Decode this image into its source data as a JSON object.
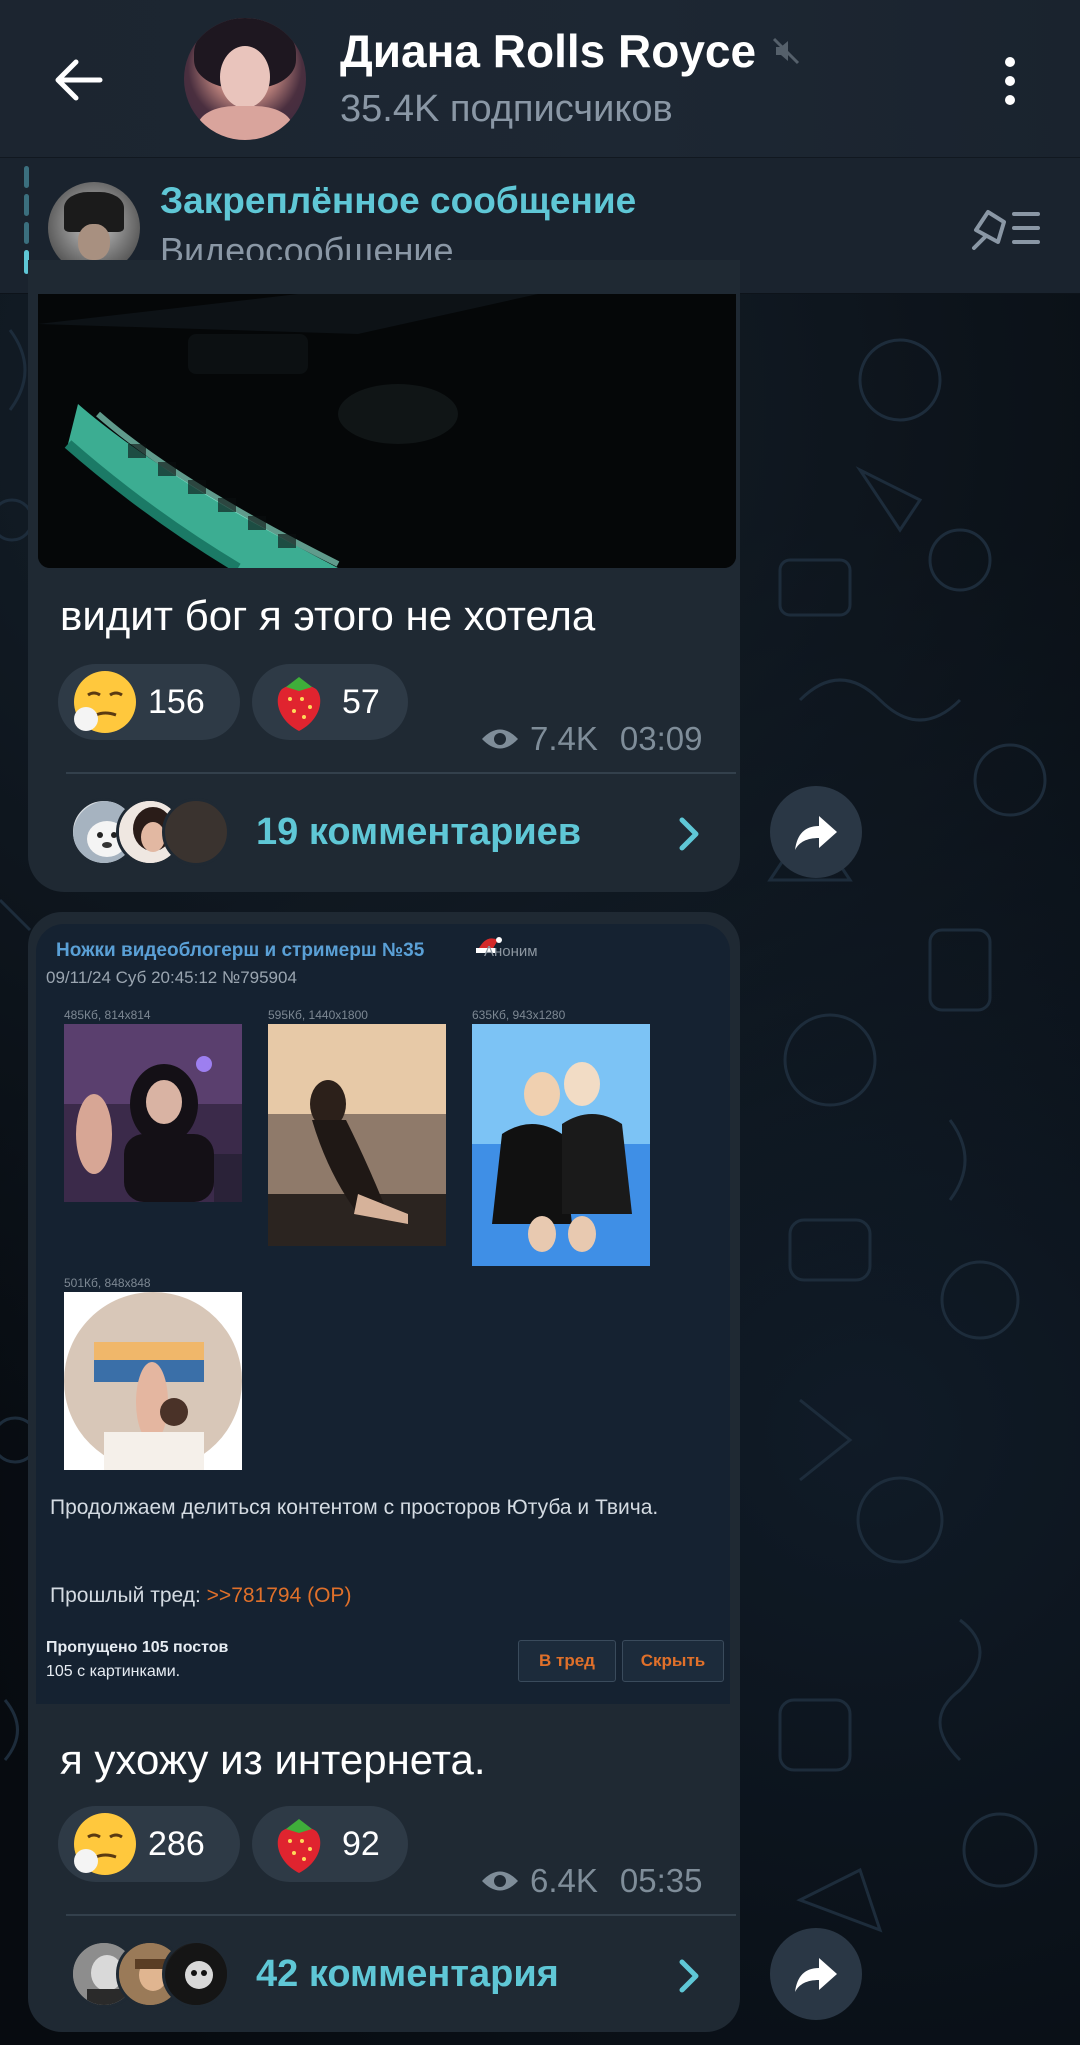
{
  "header": {
    "channel_name": "Диана Rolls Royce",
    "subscribers": "35.4K подписчиков"
  },
  "pinned": {
    "label": "Закреплённое сообщение",
    "text": "Видеосообщение"
  },
  "messages": [
    {
      "text": "видит бог я этого не хотела",
      "reactions": [
        {
          "emoji": "unamused-face-icon",
          "count": "156"
        },
        {
          "emoji": "strawberry-icon",
          "count": "57"
        }
      ],
      "views": "7.4K",
      "time": "03:09",
      "comments": "19 комментариев"
    },
    {
      "embedded_post": {
        "title": "Ножки видеоблогерш и стримерш №35",
        "author": "Аноним",
        "date": "09/11/24 Суб 20:45:12  №795904",
        "files": [
          "485Кб, 814x814",
          "595Кб, 1440x1800",
          "635Кб, 943x1280",
          "501Кб, 848x848"
        ],
        "body": "Продолжаем делиться контентом с просторов Ютуба и Твича.",
        "prev_label": "Прошлый тред:",
        "prev_link": ">>781794 (OP)",
        "skipped_line1": "Пропущено 105 постов",
        "skipped_line2": "105 с картинками.",
        "btn_thread": "В тред",
        "btn_hide": "Скрыть"
      },
      "text": "я ухожу из интернета.",
      "reactions": [
        {
          "emoji": "unamused-face-icon",
          "count": "286"
        },
        {
          "emoji": "strawberry-icon",
          "count": "92"
        }
      ],
      "views": "6.4K",
      "time": "05:35",
      "comments": "42 комментария"
    }
  ],
  "colors": {
    "accent": "#5fc7d6",
    "bubble": "#1f2933",
    "header": "#1c2530",
    "link_orange": "#e0702a"
  }
}
